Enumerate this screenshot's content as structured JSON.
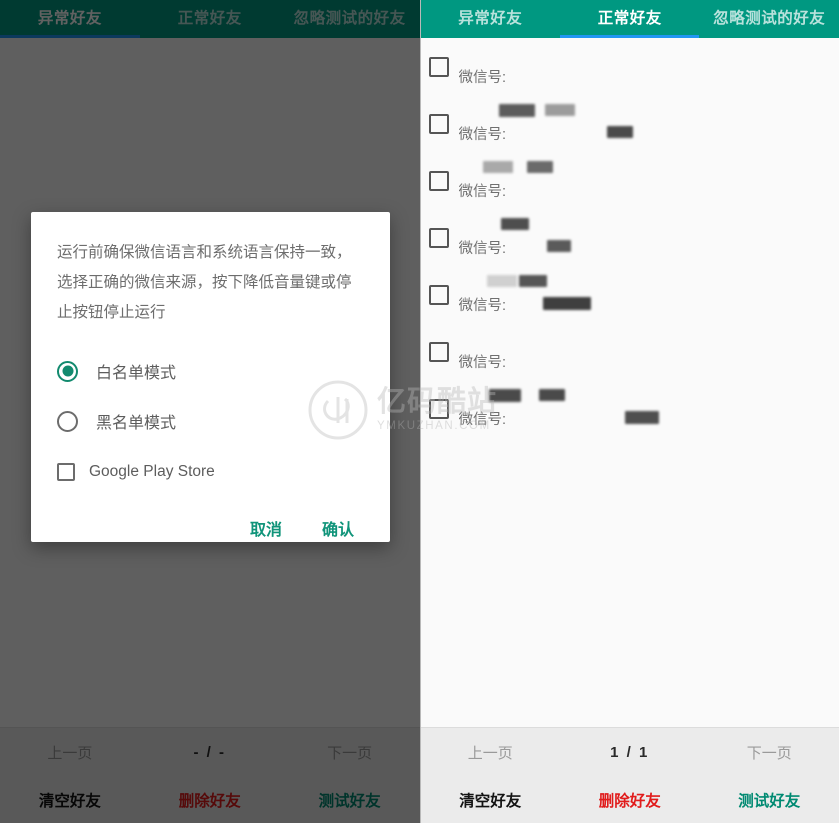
{
  "tabs": [
    {
      "label": "异常好友"
    },
    {
      "label": "正常好友"
    },
    {
      "label": "忽略测试的好友"
    }
  ],
  "left_panel": {
    "active_tab_index": 0,
    "list_rows": [],
    "pagination": {
      "prev": "上一页",
      "count": "- / -",
      "next": "下一页"
    },
    "actions": {
      "clear": "清空好友",
      "delete": "删除好友",
      "test": "测试好友"
    }
  },
  "right_panel": {
    "active_tab_index": 1,
    "wxid_label": "微信号:",
    "list_rows": [
      {
        "nickname": "",
        "wxid": ""
      },
      {
        "nickname": "",
        "wxid": ""
      },
      {
        "nickname": "",
        "wxid": ""
      },
      {
        "nickname": "",
        "wxid": ""
      },
      {
        "nickname": "",
        "wxid": ""
      },
      {
        "nickname": "",
        "wxid": ""
      },
      {
        "nickname": "",
        "wxid": ""
      }
    ],
    "pagination": {
      "prev": "上一页",
      "count": "1 / 1",
      "next": "下一页"
    },
    "actions": {
      "clear": "清空好友",
      "delete": "删除好友",
      "test": "测试好友"
    }
  },
  "dialog": {
    "message": "运行前确保微信语言和系统语言保持一致，选择正确的微信来源，按下降低音量键或停止按钮停止运行",
    "options": [
      {
        "label": "白名单模式",
        "selected": true
      },
      {
        "label": "黑名单模式",
        "selected": false
      }
    ],
    "checkbox": {
      "label": "Google Play Store",
      "checked": false
    },
    "cancel_label": "取消",
    "confirm_label": "确认"
  },
  "watermark": {
    "main": "亿码酷站",
    "sub": "YMKUZHAN.COM"
  },
  "colors": {
    "tab_bar": "#009881",
    "tab_indicator": "#2196f3",
    "accent_teal": "#10947a",
    "danger_red": "#e11b1b",
    "scrim": "rgba(0,0,0,0.62)"
  }
}
